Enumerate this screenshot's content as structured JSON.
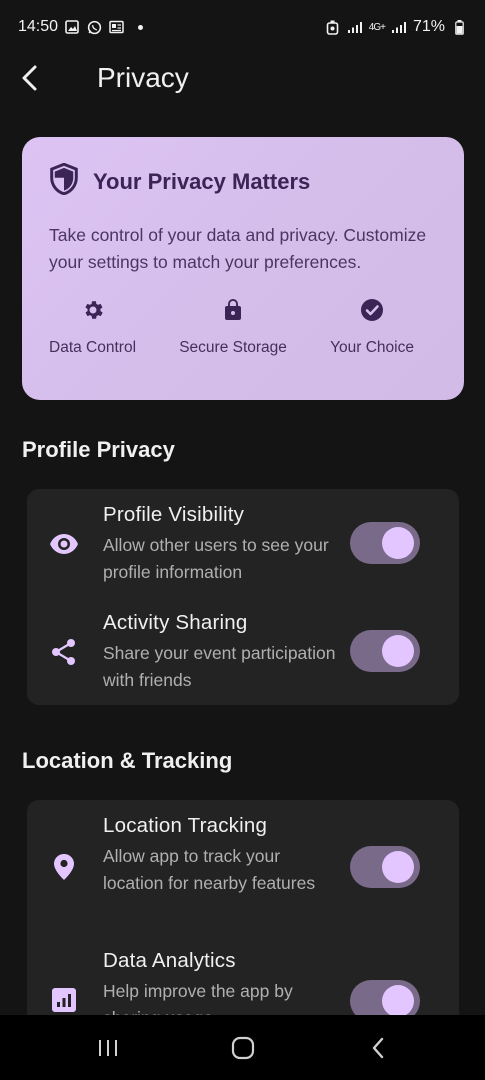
{
  "status_bar": {
    "time": "14:50",
    "battery": "71%",
    "network": "4G+"
  },
  "app_bar": {
    "title": "Privacy"
  },
  "hero": {
    "title": "Your Privacy Matters",
    "description": "Take control of your data and privacy. Customize your settings to match your preferences.",
    "features": [
      {
        "label": "Data Control",
        "icon": "gear-icon"
      },
      {
        "label": "Secure Storage",
        "icon": "lock-icon"
      },
      {
        "label": "Your Choice",
        "icon": "check-circle-icon"
      }
    ]
  },
  "sections": [
    {
      "title": "Profile Privacy",
      "items": [
        {
          "title": "Profile Visibility",
          "description": "Allow other users to see your profile information",
          "icon": "eye-icon",
          "enabled": true
        },
        {
          "title": "Activity Sharing",
          "description": "Share your event participation with friends",
          "icon": "share-icon",
          "enabled": true
        }
      ]
    },
    {
      "title": "Location & Tracking",
      "items": [
        {
          "title": "Location Tracking",
          "description": "Allow app to track your location for nearby features",
          "icon": "location-pin-icon",
          "enabled": true
        },
        {
          "title": "Data Analytics",
          "description": "Help improve the app by sharing usage",
          "icon": "analytics-icon",
          "enabled": true
        }
      ]
    }
  ],
  "colors": {
    "accent": "#e3c6ff",
    "hero_bg": "#d8c0ee",
    "card_bg": "#232323",
    "background": "#141414"
  }
}
